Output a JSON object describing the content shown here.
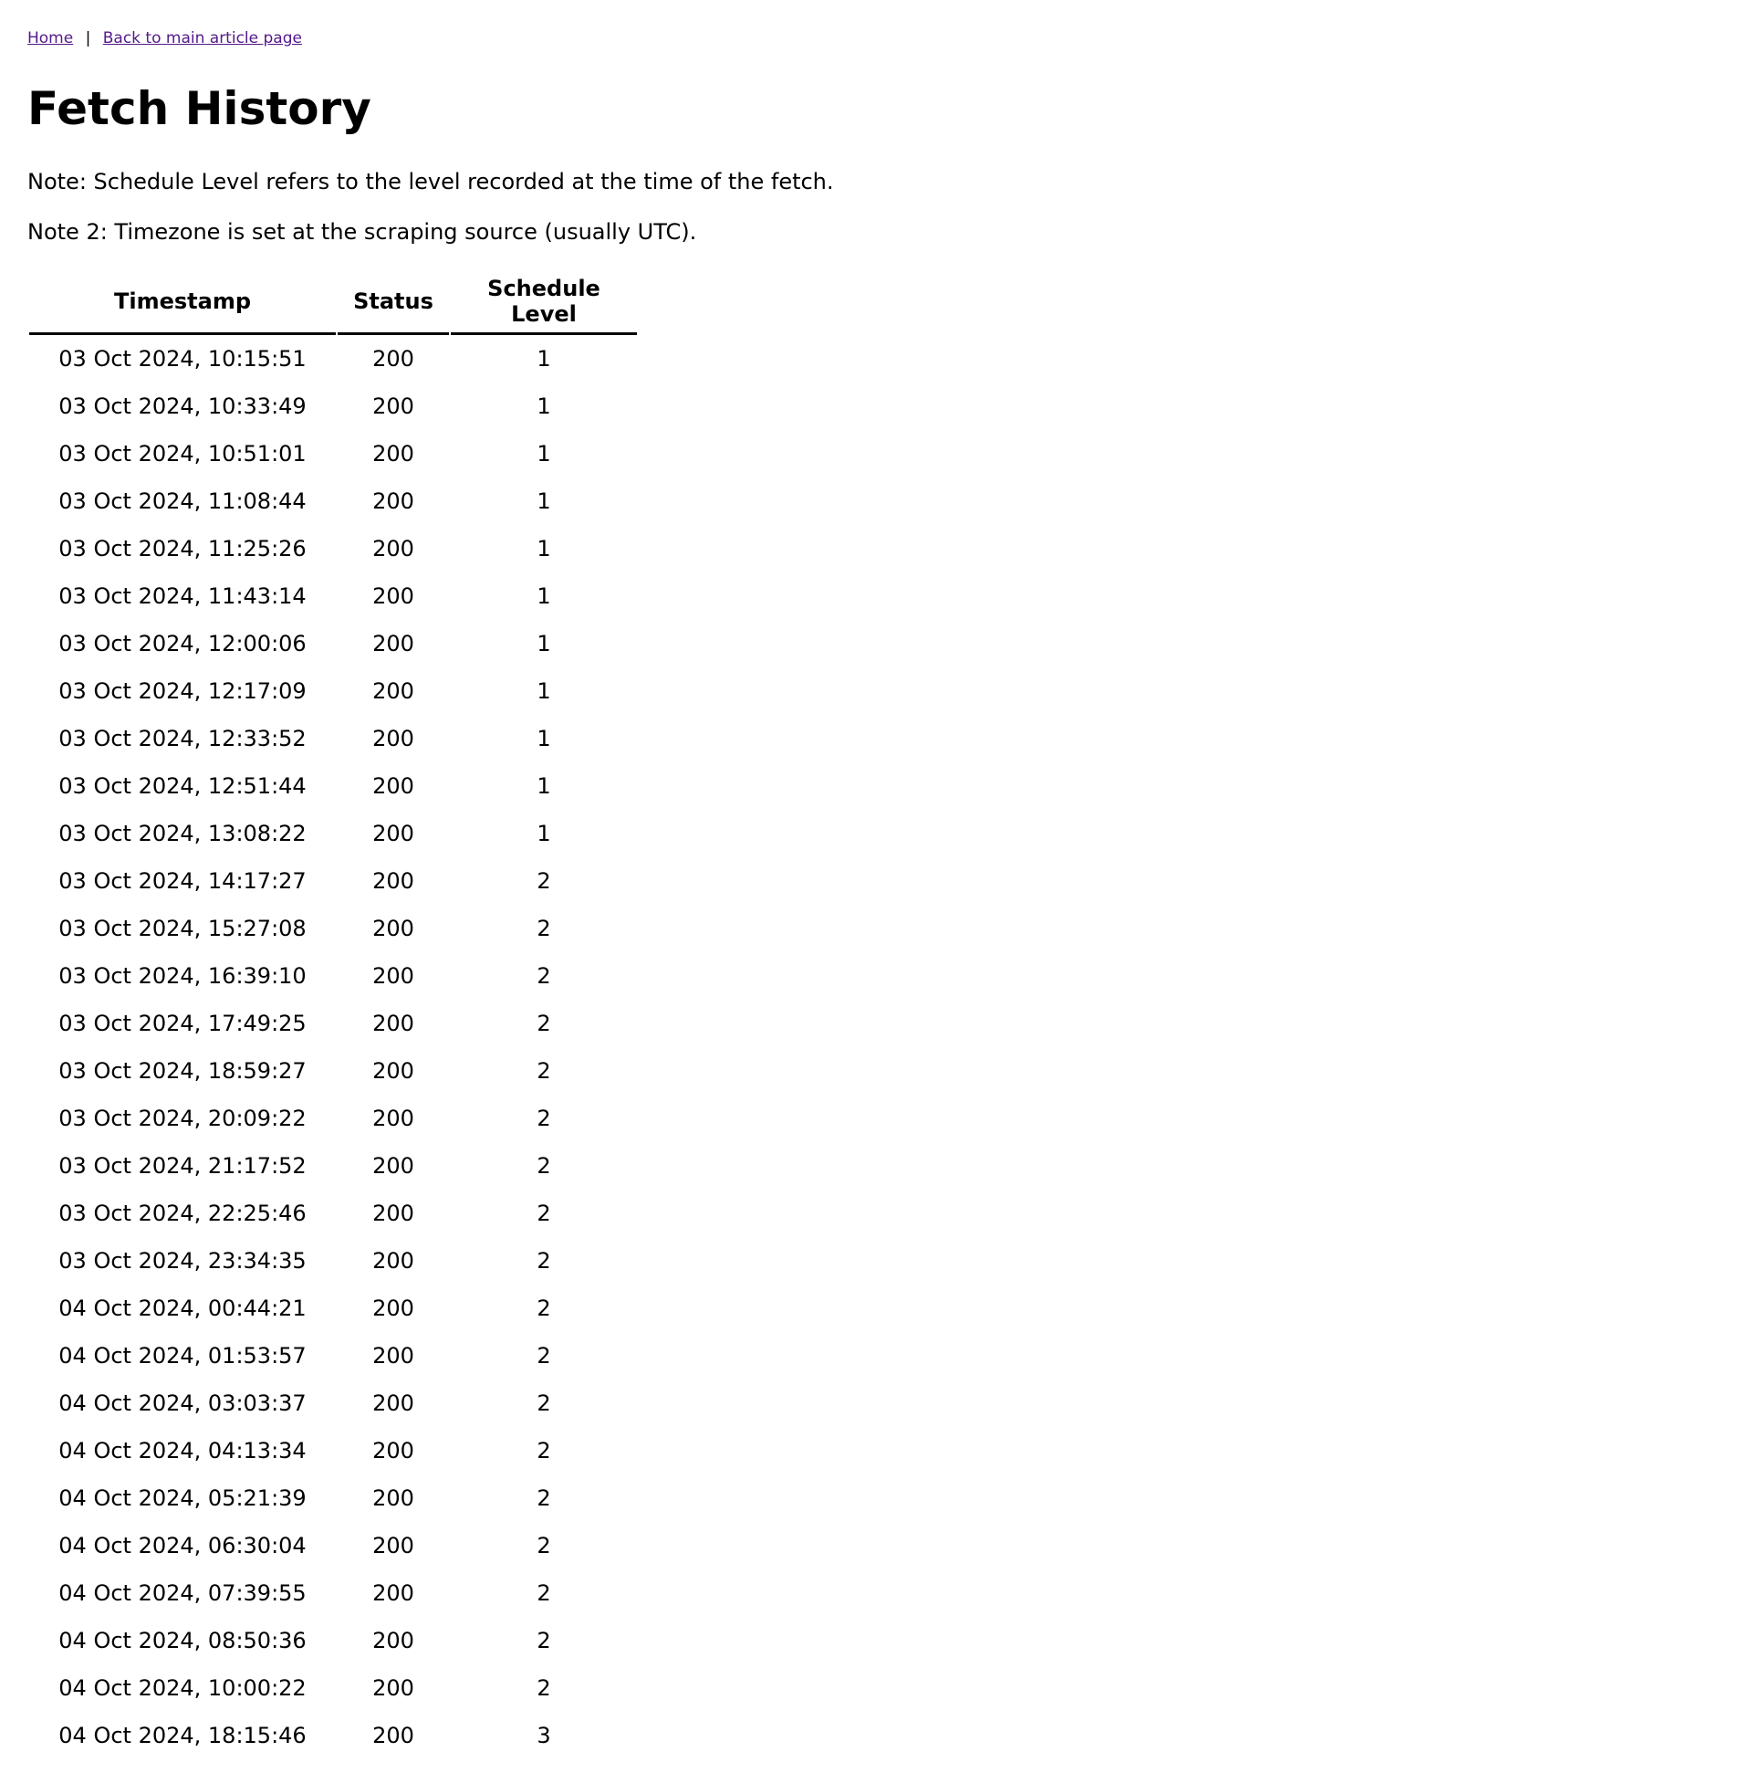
{
  "nav": {
    "home_label": "Home",
    "separator": "|",
    "back_label": "Back to main article page"
  },
  "page": {
    "title": "Fetch History",
    "note1": "Note: Schedule Level refers to the level recorded at the time of the fetch.",
    "note2": "Note 2: Timezone is set at the scraping source (usually UTC)."
  },
  "table": {
    "headers": [
      "Timestamp",
      "Status",
      "Schedule Level"
    ],
    "rows": [
      [
        "03 Oct 2024, 10:15:51",
        "200",
        "1"
      ],
      [
        "03 Oct 2024, 10:33:49",
        "200",
        "1"
      ],
      [
        "03 Oct 2024, 10:51:01",
        "200",
        "1"
      ],
      [
        "03 Oct 2024, 11:08:44",
        "200",
        "1"
      ],
      [
        "03 Oct 2024, 11:25:26",
        "200",
        "1"
      ],
      [
        "03 Oct 2024, 11:43:14",
        "200",
        "1"
      ],
      [
        "03 Oct 2024, 12:00:06",
        "200",
        "1"
      ],
      [
        "03 Oct 2024, 12:17:09",
        "200",
        "1"
      ],
      [
        "03 Oct 2024, 12:33:52",
        "200",
        "1"
      ],
      [
        "03 Oct 2024, 12:51:44",
        "200",
        "1"
      ],
      [
        "03 Oct 2024, 13:08:22",
        "200",
        "1"
      ],
      [
        "03 Oct 2024, 14:17:27",
        "200",
        "2"
      ],
      [
        "03 Oct 2024, 15:27:08",
        "200",
        "2"
      ],
      [
        "03 Oct 2024, 16:39:10",
        "200",
        "2"
      ],
      [
        "03 Oct 2024, 17:49:25",
        "200",
        "2"
      ],
      [
        "03 Oct 2024, 18:59:27",
        "200",
        "2"
      ],
      [
        "03 Oct 2024, 20:09:22",
        "200",
        "2"
      ],
      [
        "03 Oct 2024, 21:17:52",
        "200",
        "2"
      ],
      [
        "03 Oct 2024, 22:25:46",
        "200",
        "2"
      ],
      [
        "03 Oct 2024, 23:34:35",
        "200",
        "2"
      ],
      [
        "04 Oct 2024, 00:44:21",
        "200",
        "2"
      ],
      [
        "04 Oct 2024, 01:53:57",
        "200",
        "2"
      ],
      [
        "04 Oct 2024, 03:03:37",
        "200",
        "2"
      ],
      [
        "04 Oct 2024, 04:13:34",
        "200",
        "2"
      ],
      [
        "04 Oct 2024, 05:21:39",
        "200",
        "2"
      ],
      [
        "04 Oct 2024, 06:30:04",
        "200",
        "2"
      ],
      [
        "04 Oct 2024, 07:39:55",
        "200",
        "2"
      ],
      [
        "04 Oct 2024, 08:50:36",
        "200",
        "2"
      ],
      [
        "04 Oct 2024, 10:00:22",
        "200",
        "2"
      ],
      [
        "04 Oct 2024, 18:15:46",
        "200",
        "3"
      ]
    ]
  },
  "colors": {
    "link": "#551a8b",
    "text": "#000000",
    "background": "#ffffff"
  }
}
